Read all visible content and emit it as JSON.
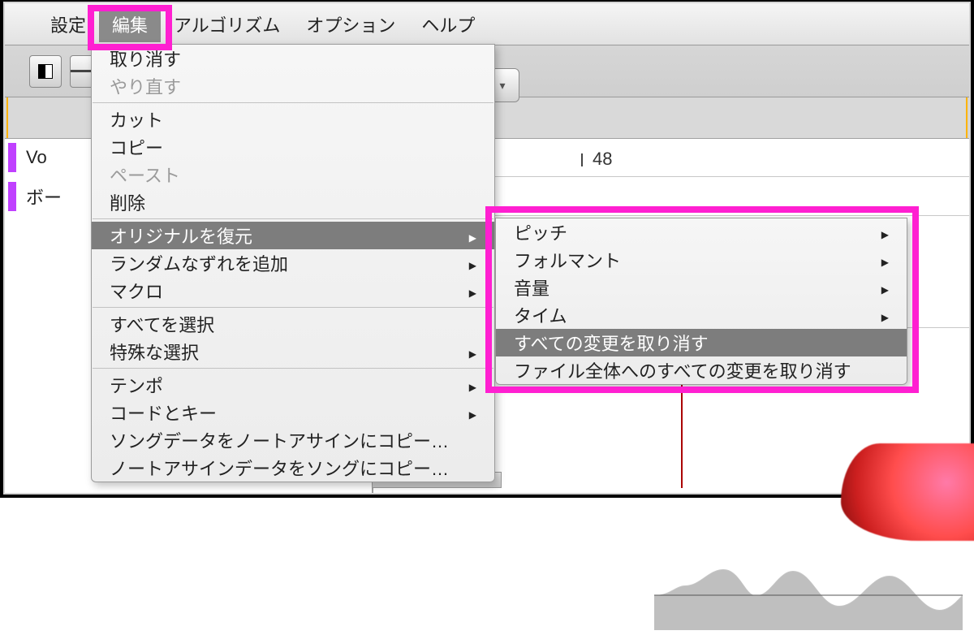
{
  "menubar": {
    "items": [
      "設定",
      "編集",
      "アルゴリズム",
      "オプション",
      "ヘルプ"
    ],
    "active_index": 1
  },
  "tracklist": {
    "items": [
      "Vo",
      "ボー"
    ]
  },
  "ruler": {
    "label48": "48"
  },
  "edit_menu": {
    "items": [
      {
        "label": "取り消す",
        "enabled": true
      },
      {
        "label": "やり直す",
        "enabled": false
      },
      {
        "sep": true
      },
      {
        "label": "カット",
        "enabled": true
      },
      {
        "label": "コピー",
        "enabled": true
      },
      {
        "label": "ペースト",
        "enabled": false
      },
      {
        "label": "削除",
        "enabled": true
      },
      {
        "sep": true
      },
      {
        "label": "オリジナルを復元",
        "enabled": true,
        "selected": true,
        "submenu": true
      },
      {
        "label": "ランダムなずれを追加",
        "enabled": true,
        "submenu": true
      },
      {
        "label": "マクロ",
        "enabled": true,
        "submenu": true
      },
      {
        "sep": true
      },
      {
        "label": "すべてを選択",
        "enabled": true
      },
      {
        "label": "特殊な選択",
        "enabled": true,
        "submenu": true
      },
      {
        "sep": true
      },
      {
        "label": "テンポ",
        "enabled": true,
        "submenu": true
      },
      {
        "label": "コードとキー",
        "enabled": true,
        "submenu": true
      },
      {
        "label": "ソングデータをノートアサインにコピー…",
        "enabled": true
      },
      {
        "label": "ノートアサインデータをソングにコピー…",
        "enabled": true
      }
    ]
  },
  "sub_menu": {
    "items": [
      {
        "label": "ピッチ",
        "submenu": true
      },
      {
        "label": "フォルマント",
        "submenu": true
      },
      {
        "label": "音量",
        "submenu": true
      },
      {
        "label": "タイム",
        "submenu": true
      },
      {
        "label": "すべての変更を取り消す",
        "selected": true
      },
      {
        "label": "ファイル全体へのすべての変更を取り消す"
      }
    ]
  },
  "colors": {
    "highlight": "#ff1fd1",
    "selection": "#7d7d7d",
    "track_accent": "#c040ff"
  }
}
